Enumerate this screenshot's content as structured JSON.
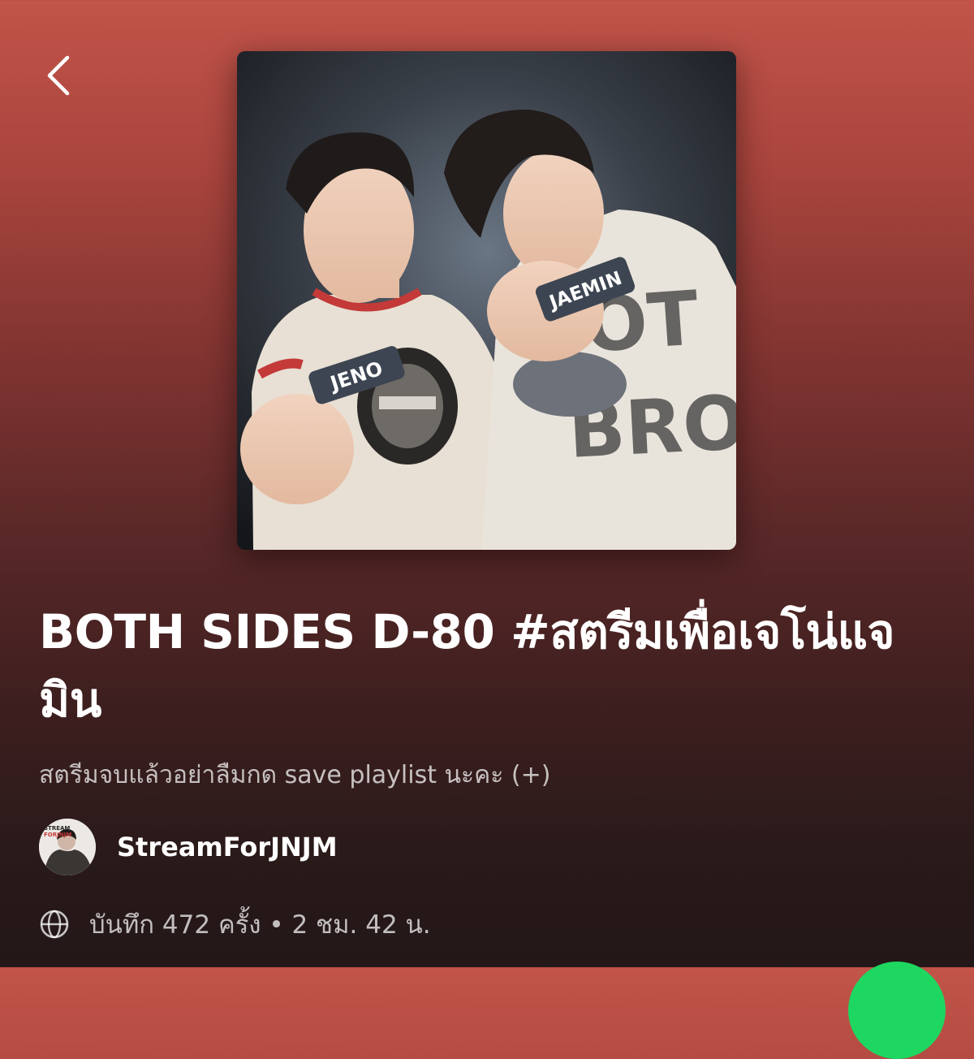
{
  "header": {
    "back_icon": "chevron-left-icon"
  },
  "cover": {
    "description": "Playlist cover photo",
    "card_left": "JENO",
    "card_right": "JAEMIN",
    "shirt_right_text": "NOT BROK"
  },
  "playlist": {
    "title": "BOTH SIDES D-80 #สตรีมเพื่อเจโน่แจมิน",
    "description": "สตรีมจบแล้วอย่าลืมกด save playlist นะคะ (+)"
  },
  "owner": {
    "name": "StreamForJNJM",
    "avatar_text": "STREAM FORJNJM"
  },
  "meta": {
    "icon": "globe-icon",
    "text": "บันทึก 472 ครั้ง • 2 ชม. 42 น."
  },
  "colors": {
    "background_top": "#c25449",
    "background_bottom": "#231717",
    "play_button": "#1ed760"
  }
}
